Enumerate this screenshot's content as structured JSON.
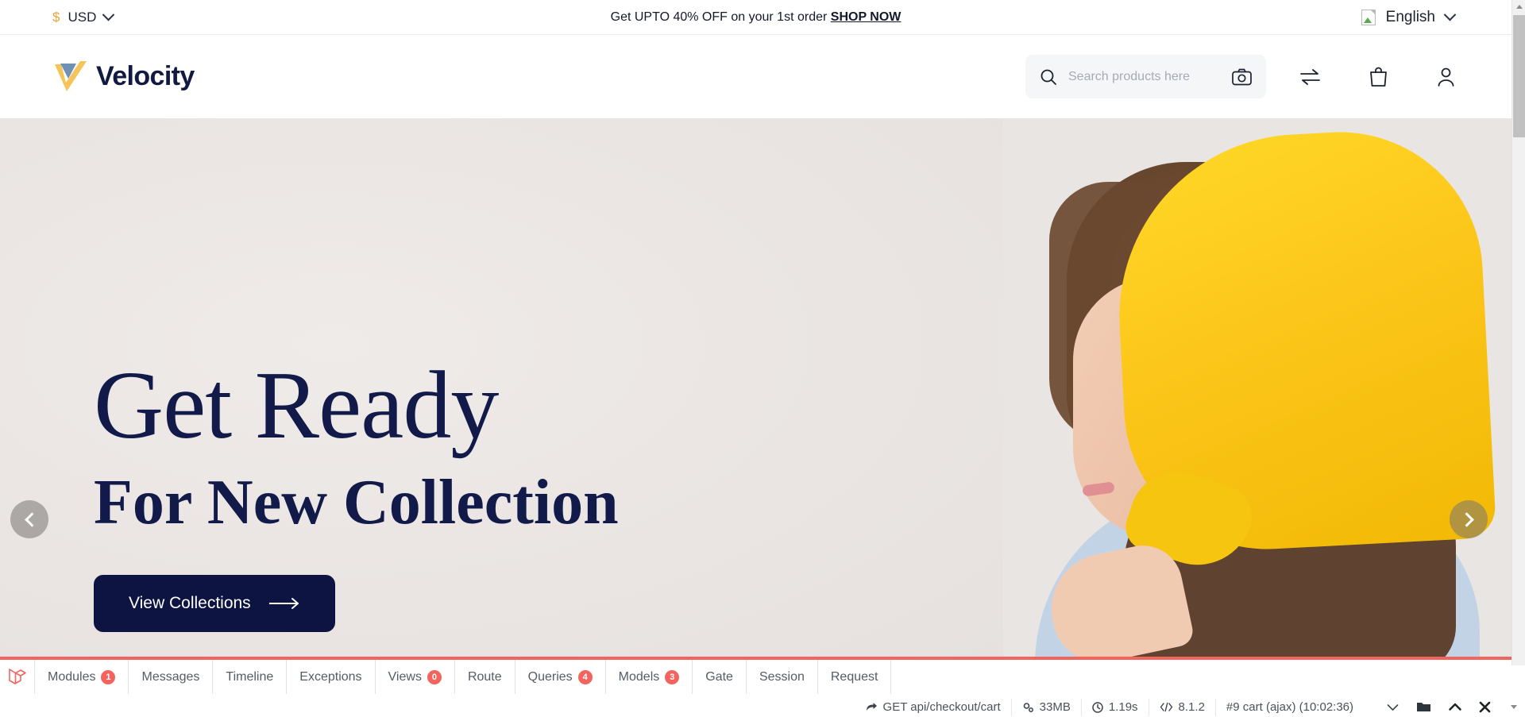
{
  "topbar": {
    "currency": {
      "symbol": "$",
      "code": "USD",
      "chevron_icon": "chevron-down-icon"
    },
    "promo": {
      "text": "Get UPTO 40% OFF on your 1st order",
      "link_label": "SHOP NOW"
    },
    "language": {
      "label": "English",
      "flag_icon": "broken-image-icon",
      "chevron_icon": "chevron-down-icon"
    }
  },
  "header": {
    "brand": "Velocity",
    "logo_icon": "velocity-check-logo",
    "search": {
      "placeholder": "Search products here",
      "search_icon": "search-icon",
      "camera_icon": "camera-icon"
    },
    "icons": [
      {
        "name": "compare-icon",
        "label": "Compare"
      },
      {
        "name": "cart-bag-icon",
        "label": "Cart"
      },
      {
        "name": "user-account-icon",
        "label": "Account"
      }
    ]
  },
  "hero": {
    "headline_line1": "Get Ready",
    "headline_line2": "For New Collection",
    "cta_label": "View Collections",
    "cta_arrow": "→",
    "prev_label": "Previous slide",
    "next_label": "Next slide",
    "bg_color": "#eae6e4",
    "text_color": "#121a4a",
    "cta_color": "#0d1442"
  },
  "debugbar": {
    "logo_icon": "laravel-logo-icon",
    "accent_color": "#f4645f",
    "tabs": [
      {
        "label": "Modules",
        "badge": "1"
      },
      {
        "label": "Messages",
        "badge": null
      },
      {
        "label": "Timeline",
        "badge": null
      },
      {
        "label": "Exceptions",
        "badge": null
      },
      {
        "label": "Views",
        "badge": "0"
      },
      {
        "label": "Route",
        "badge": null
      },
      {
        "label": "Queries",
        "badge": "4"
      },
      {
        "label": "Models",
        "badge": "3"
      },
      {
        "label": "Gate",
        "badge": null
      },
      {
        "label": "Session",
        "badge": null
      },
      {
        "label": "Request",
        "badge": null
      }
    ],
    "status": [
      {
        "icon": "share-arrow-icon",
        "text": "GET api/checkout/cart"
      },
      {
        "icon": "gears-icon",
        "text": "33MB"
      },
      {
        "icon": "clock-icon",
        "text": "1.19s"
      },
      {
        "icon": "code-icon",
        "text": "8.1.2"
      },
      {
        "icon": null,
        "text": "#9 cart (ajax) (10:02:36)"
      }
    ],
    "controls": [
      {
        "name": "chevron-down-icon"
      },
      {
        "name": "folder-icon"
      },
      {
        "name": "chevron-up-icon"
      },
      {
        "name": "close-icon"
      }
    ]
  }
}
